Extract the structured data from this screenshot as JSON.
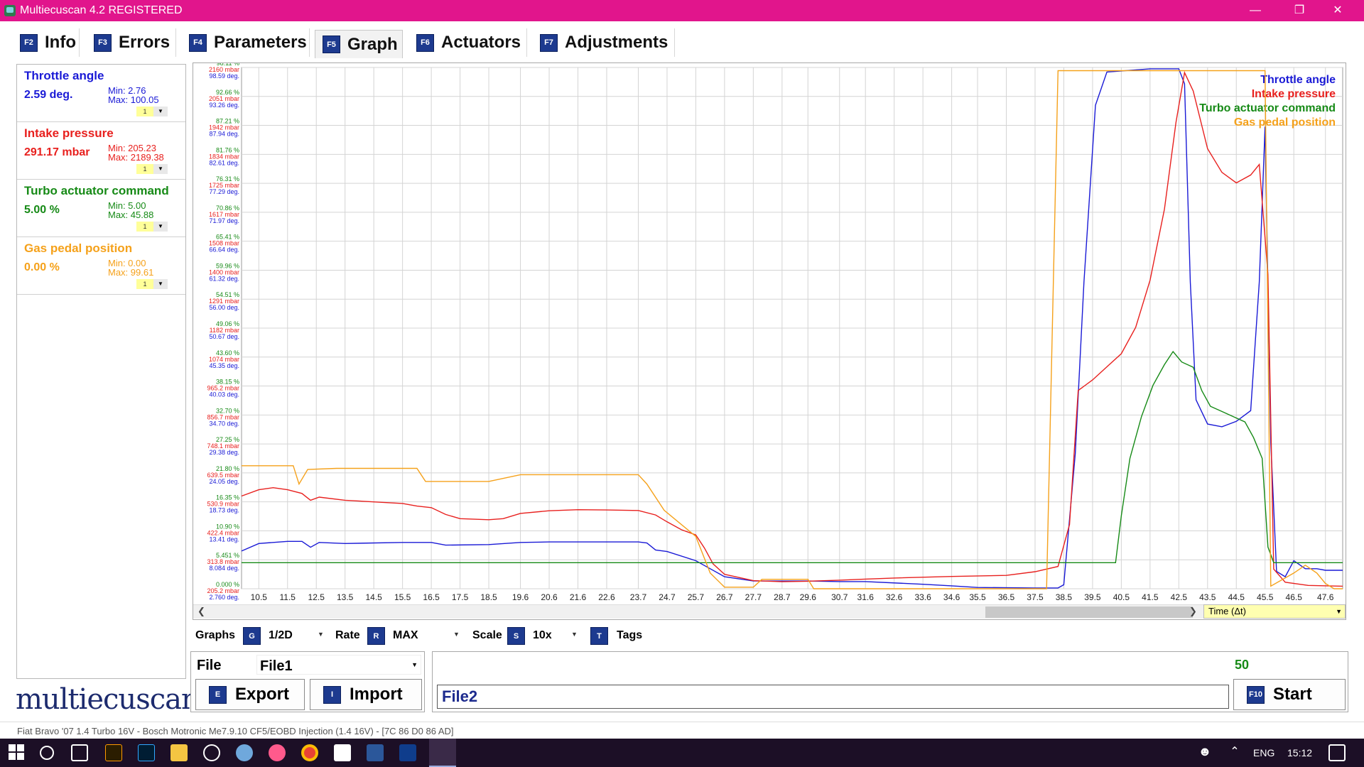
{
  "window": {
    "title": "Multiecuscan 4.2 REGISTERED"
  },
  "tabs": [
    {
      "key": "F2",
      "label": "Info"
    },
    {
      "key": "F3",
      "label": "Errors"
    },
    {
      "key": "F4",
      "label": "Parameters"
    },
    {
      "key": "F5",
      "label": "Graph",
      "active": true
    },
    {
      "key": "F6",
      "label": "Actuators"
    },
    {
      "key": "F7",
      "label": "Adjustments"
    }
  ],
  "parameters": [
    {
      "name": "Throttle angle",
      "value": "2.59 deg.",
      "min": "Min: 2.76",
      "max": "Max: 100.05",
      "scale": "1",
      "color": "#1a1ad6"
    },
    {
      "name": "Intake pressure",
      "value": "291.17 mbar",
      "min": "Min: 205.23",
      "max": "Max: 2189.38",
      "scale": "1",
      "color": "#e8201e"
    },
    {
      "name": "Turbo actuator command",
      "value": "5.00 %",
      "min": "Min: 5.00",
      "max": "Max: 45.88",
      "scale": "1",
      "color": "#168a16"
    },
    {
      "name": "Gas pedal position",
      "value": "0.00 %",
      "min": "Min: 0.00",
      "max": "Max: 99.61",
      "scale": "1",
      "color": "#f5a11a"
    }
  ],
  "logo": "multiecuscan",
  "graph": {
    "time_combo": "Time (Δt)",
    "controls": {
      "graphs_label": "Graphs",
      "graphs_key": "G",
      "graphs_value": "1/2D",
      "rate_label": "Rate",
      "rate_key": "R",
      "rate_value": "MAX",
      "scale_label": "Scale",
      "scale_key": "S",
      "scale_value": "10x",
      "tags_key": "T",
      "tags_label": "Tags"
    }
  },
  "file_panel": {
    "file_label": "File",
    "file_value": "File1",
    "export_key": "E",
    "export_label": "Export",
    "import_key": "I",
    "import_label": "Import",
    "counter": "50",
    "file2_value": "File2",
    "start_key": "F10",
    "start_label": "Start"
  },
  "status": "Fiat Bravo '07 1.4 Turbo 16V - Bosch Motronic Me7.9.10 CF5/EOBD Injection (1.4 16V) - [7C 86 D0 86 AD]",
  "taskbar": {
    "language": "ENG",
    "time": "15:12"
  },
  "chart_data": {
    "type": "line",
    "xlabel": "Time (Δt)",
    "x_ticks": [
      "10.5",
      "11.5",
      "12.5",
      "13.5",
      "14.5",
      "15.5",
      "16.5",
      "17.5",
      "18.5",
      "19.6",
      "20.6",
      "21.6",
      "22.6",
      "23.7",
      "24.7",
      "25.7",
      "26.7",
      "27.7",
      "28.7",
      "29.6",
      "30.7",
      "31.6",
      "32.6",
      "33.6",
      "34.6",
      "35.5",
      "36.5",
      "37.5",
      "38.5",
      "39.5",
      "40.5",
      "41.5",
      "42.5",
      "43.5",
      "44.5",
      "45.5",
      "46.5",
      "47.6"
    ],
    "y_axis_label_rows": [
      {
        "pct": "98.11 %",
        "mbar": "2160 mbar",
        "deg": "98.59 deg."
      },
      {
        "pct": "92.66 %",
        "mbar": "2051 mbar",
        "deg": "93.26 deg."
      },
      {
        "pct": "87.21 %",
        "mbar": "1942 mbar",
        "deg": "87.94 deg."
      },
      {
        "pct": "81.76 %",
        "mbar": "1834 mbar",
        "deg": "82.61 deg."
      },
      {
        "pct": "76.31 %",
        "mbar": "1725 mbar",
        "deg": "77.29 deg."
      },
      {
        "pct": "70.86 %",
        "mbar": "1617 mbar",
        "deg": "71.97 deg."
      },
      {
        "pct": "65.41 %",
        "mbar": "1508 mbar",
        "deg": "66.64 deg."
      },
      {
        "pct": "59.96 %",
        "mbar": "1400 mbar",
        "deg": "61.32 deg."
      },
      {
        "pct": "54.51 %",
        "mbar": "1291 mbar",
        "deg": "56.00 deg."
      },
      {
        "pct": "49.06 %",
        "mbar": "1182 mbar",
        "deg": "50.67 deg."
      },
      {
        "pct": "43.60 %",
        "mbar": "1074 mbar",
        "deg": "45.35 deg."
      },
      {
        "pct": "38.15 %",
        "mbar": "965.2 mbar",
        "deg": "40.03 deg."
      },
      {
        "pct": "32.70 %",
        "mbar": "856.7 mbar",
        "deg": "34.70 deg."
      },
      {
        "pct": "27.25 %",
        "mbar": "748.1 mbar",
        "deg": "29.38 deg."
      },
      {
        "pct": "21.80 %",
        "mbar": "639.5 mbar",
        "deg": "24.05 deg."
      },
      {
        "pct": "16.35 %",
        "mbar": "530.9 mbar",
        "deg": "18.73 deg."
      },
      {
        "pct": "10.90 %",
        "mbar": "422.4 mbar",
        "deg": "13.41 deg."
      },
      {
        "pct": "5.451 %",
        "mbar": "313.8 mbar",
        "deg": "8.084 deg."
      },
      {
        "pct": "0.000 %",
        "mbar": "205.2 mbar",
        "deg": "2.760 deg."
      }
    ],
    "legend_position": "top-right",
    "grid": true,
    "xlim": [
      9.9,
      48.2
    ],
    "series": [
      {
        "name": "Throttle angle",
        "color": "#1a1ad6",
        "points": [
          [
            9.9,
            9.8
          ],
          [
            10.5,
            11.2
          ],
          [
            11.5,
            11.6
          ],
          [
            12.0,
            11.6
          ],
          [
            12.3,
            10.5
          ],
          [
            12.6,
            11.4
          ],
          [
            13.5,
            11.2
          ],
          [
            15.5,
            11.4
          ],
          [
            16.5,
            11.4
          ],
          [
            17.0,
            10.9
          ],
          [
            18.5,
            11.0
          ],
          [
            19.6,
            11.4
          ],
          [
            20.6,
            11.5
          ],
          [
            22.6,
            11.5
          ],
          [
            23.7,
            11.5
          ],
          [
            24.0,
            11.3
          ],
          [
            24.3,
            10.0
          ],
          [
            24.7,
            9.7
          ],
          [
            25.7,
            8.0
          ],
          [
            26.2,
            6.5
          ],
          [
            26.7,
            5.0
          ],
          [
            27.7,
            4.2
          ],
          [
            29.6,
            4.2
          ],
          [
            30.7,
            4.1
          ],
          [
            31.6,
            4.1
          ],
          [
            33.6,
            3.6
          ],
          [
            34.6,
            3.3
          ],
          [
            35.5,
            3.0
          ],
          [
            37.5,
            2.9
          ],
          [
            38.3,
            2.9
          ],
          [
            38.5,
            3.5
          ],
          [
            38.9,
            28.0
          ],
          [
            39.2,
            60.0
          ],
          [
            39.6,
            93.0
          ],
          [
            40.0,
            99.2
          ],
          [
            41.5,
            99.8
          ],
          [
            42.5,
            99.8
          ],
          [
            42.7,
            97.0
          ],
          [
            42.9,
            60.0
          ],
          [
            43.1,
            38.0
          ],
          [
            43.5,
            33.5
          ],
          [
            44.0,
            33.0
          ],
          [
            44.5,
            34.0
          ],
          [
            45.0,
            36.0
          ],
          [
            45.3,
            60.0
          ],
          [
            45.5,
            89.0
          ],
          [
            45.7,
            30.0
          ],
          [
            45.9,
            6.0
          ],
          [
            46.2,
            5.0
          ],
          [
            46.5,
            8.0
          ],
          [
            46.9,
            6.5
          ],
          [
            47.3,
            6.5
          ],
          [
            47.6,
            6.2
          ],
          [
            48.2,
            6.2
          ]
        ]
      },
      {
        "name": "Intake pressure",
        "color": "#e8201e",
        "points": [
          [
            9.9,
            558
          ],
          [
            10.5,
            582
          ],
          [
            11.0,
            590
          ],
          [
            11.5,
            582
          ],
          [
            12.0,
            568
          ],
          [
            12.3,
            542
          ],
          [
            12.6,
            554
          ],
          [
            13.5,
            542
          ],
          [
            15.5,
            530
          ],
          [
            16.0,
            520
          ],
          [
            16.5,
            514
          ],
          [
            17.0,
            488
          ],
          [
            17.5,
            472
          ],
          [
            18.5,
            468
          ],
          [
            19.0,
            472
          ],
          [
            19.6,
            492
          ],
          [
            20.6,
            502
          ],
          [
            21.6,
            506
          ],
          [
            22.6,
            505
          ],
          [
            23.7,
            503
          ],
          [
            24.3,
            486
          ],
          [
            24.7,
            460
          ],
          [
            25.2,
            430
          ],
          [
            25.7,
            410
          ],
          [
            26.0,
            360
          ],
          [
            26.3,
            300
          ],
          [
            26.7,
            260
          ],
          [
            27.7,
            236
          ],
          [
            28.7,
            232
          ],
          [
            29.6,
            234
          ],
          [
            30.7,
            238
          ],
          [
            31.6,
            242
          ],
          [
            32.6,
            246
          ],
          [
            34.6,
            252
          ],
          [
            36.5,
            256
          ],
          [
            37.5,
            270
          ],
          [
            38.3,
            290
          ],
          [
            38.7,
            450
          ],
          [
            39.0,
            960
          ],
          [
            39.5,
            1000
          ],
          [
            40.0,
            1050
          ],
          [
            40.5,
            1100
          ],
          [
            41.0,
            1200
          ],
          [
            41.5,
            1380
          ],
          [
            42.0,
            1650
          ],
          [
            42.4,
            1980
          ],
          [
            42.7,
            2170
          ],
          [
            43.0,
            2100
          ],
          [
            43.5,
            1880
          ],
          [
            44.0,
            1790
          ],
          [
            44.5,
            1750
          ],
          [
            45.0,
            1780
          ],
          [
            45.3,
            1820
          ],
          [
            45.6,
            1400
          ],
          [
            45.8,
            280
          ],
          [
            46.2,
            230
          ],
          [
            47.0,
            218
          ],
          [
            48.2,
            215
          ]
        ]
      },
      {
        "name": "Turbo actuator command",
        "color": "#168a16",
        "points": [
          [
            9.9,
            5.0
          ],
          [
            40.3,
            5.0
          ],
          [
            40.5,
            14.0
          ],
          [
            40.8,
            25.0
          ],
          [
            41.2,
            33.0
          ],
          [
            41.6,
            39.0
          ],
          [
            42.0,
            43.0
          ],
          [
            42.3,
            45.5
          ],
          [
            42.6,
            43.5
          ],
          [
            43.0,
            42.5
          ],
          [
            43.3,
            38.0
          ],
          [
            43.6,
            35.0
          ],
          [
            44.0,
            34.0
          ],
          [
            44.4,
            33.0
          ],
          [
            44.8,
            32.0
          ],
          [
            45.1,
            29.0
          ],
          [
            45.4,
            25.0
          ],
          [
            45.6,
            8.0
          ],
          [
            45.8,
            5.0
          ],
          [
            48.2,
            5.0
          ]
        ]
      },
      {
        "name": "Gas pedal position",
        "color": "#f5a11a",
        "points": [
          [
            9.9,
            23.5
          ],
          [
            11.3,
            23.5
          ],
          [
            11.7,
            23.5
          ],
          [
            11.9,
            20.0
          ],
          [
            12.2,
            22.8
          ],
          [
            13.2,
            23.0
          ],
          [
            16.0,
            23.0
          ],
          [
            16.3,
            20.5
          ],
          [
            18.5,
            20.5
          ],
          [
            19.6,
            21.8
          ],
          [
            22.6,
            21.8
          ],
          [
            23.7,
            21.8
          ],
          [
            24.0,
            20.0
          ],
          [
            24.6,
            15.0
          ],
          [
            25.7,
            10.0
          ],
          [
            26.2,
            3.0
          ],
          [
            26.7,
            0.3
          ],
          [
            27.7,
            0.3
          ],
          [
            28.0,
            1.8
          ],
          [
            29.6,
            1.8
          ],
          [
            29.8,
            0.0
          ],
          [
            37.9,
            0.0
          ],
          [
            38.3,
            99.0
          ],
          [
            42.0,
            99.0
          ],
          [
            45.5,
            99.0
          ],
          [
            45.7,
            0.5
          ],
          [
            46.5,
            3.0
          ],
          [
            46.9,
            4.5
          ],
          [
            47.3,
            3.0
          ],
          [
            47.6,
            1.0
          ],
          [
            47.9,
            0.0
          ],
          [
            48.2,
            0.0
          ]
        ]
      }
    ],
    "y_ranges": {
      "Throttle angle": [
        2.76,
        100.05
      ],
      "Intake pressure": [
        205.23,
        2189.38
      ],
      "Turbo actuator command": [
        0,
        100
      ],
      "Gas pedal position": [
        0,
        99.61
      ]
    }
  }
}
